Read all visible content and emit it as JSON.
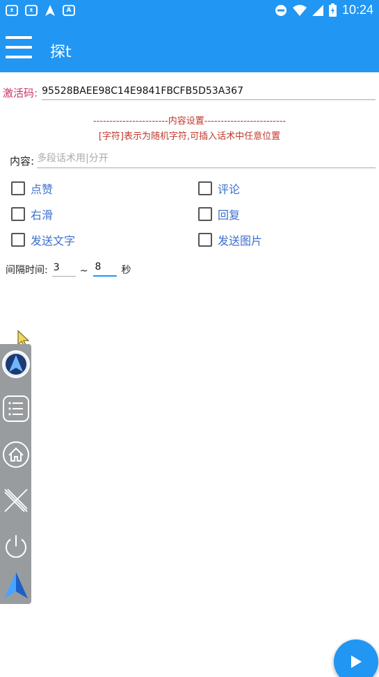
{
  "status_bar": {
    "time": "10:24",
    "left_icons": [
      "cat-face-icon",
      "cat-face-icon",
      "navigation-arrow-icon",
      "a-box-icon"
    ],
    "right_icons": [
      "minus-circle-icon",
      "wifi-icon",
      "signal-icon",
      "battery-icon"
    ]
  },
  "app_bar": {
    "title": "探t",
    "menu_icon": "hamburger-icon"
  },
  "activation": {
    "label": "激活码:",
    "value": "95528BAEE98C14E9841FBCFB5D53A367"
  },
  "section": {
    "divider_title": "-----------------------内容设置-------------------------",
    "hint": "[字符]表示为随机字符,可插入话术中任意位置"
  },
  "content": {
    "label": "内容:",
    "placeholder": "多段话术用|分开",
    "value": ""
  },
  "options": {
    "like": "点赞",
    "comment": "评论",
    "swipe_right": "右滑",
    "reply": "回复",
    "send_text": "发送文字",
    "send_image": "发送图片"
  },
  "interval": {
    "label": "间隔时间:",
    "min": "3",
    "separator": "~",
    "max": "8",
    "unit": "秒"
  },
  "floating_toolbar": {
    "icons": [
      "app-logo-icon",
      "list-icon",
      "home-icon",
      "close-icon",
      "power-icon",
      "navigation-arrow-icon"
    ]
  },
  "fab": {
    "icon": "play-icon"
  },
  "colors": {
    "primary": "#2196F3",
    "activation_label": "#cc3366",
    "section_text": "#c0392b",
    "option_text": "#3b6fd0",
    "floatbar": "#999c9f"
  }
}
